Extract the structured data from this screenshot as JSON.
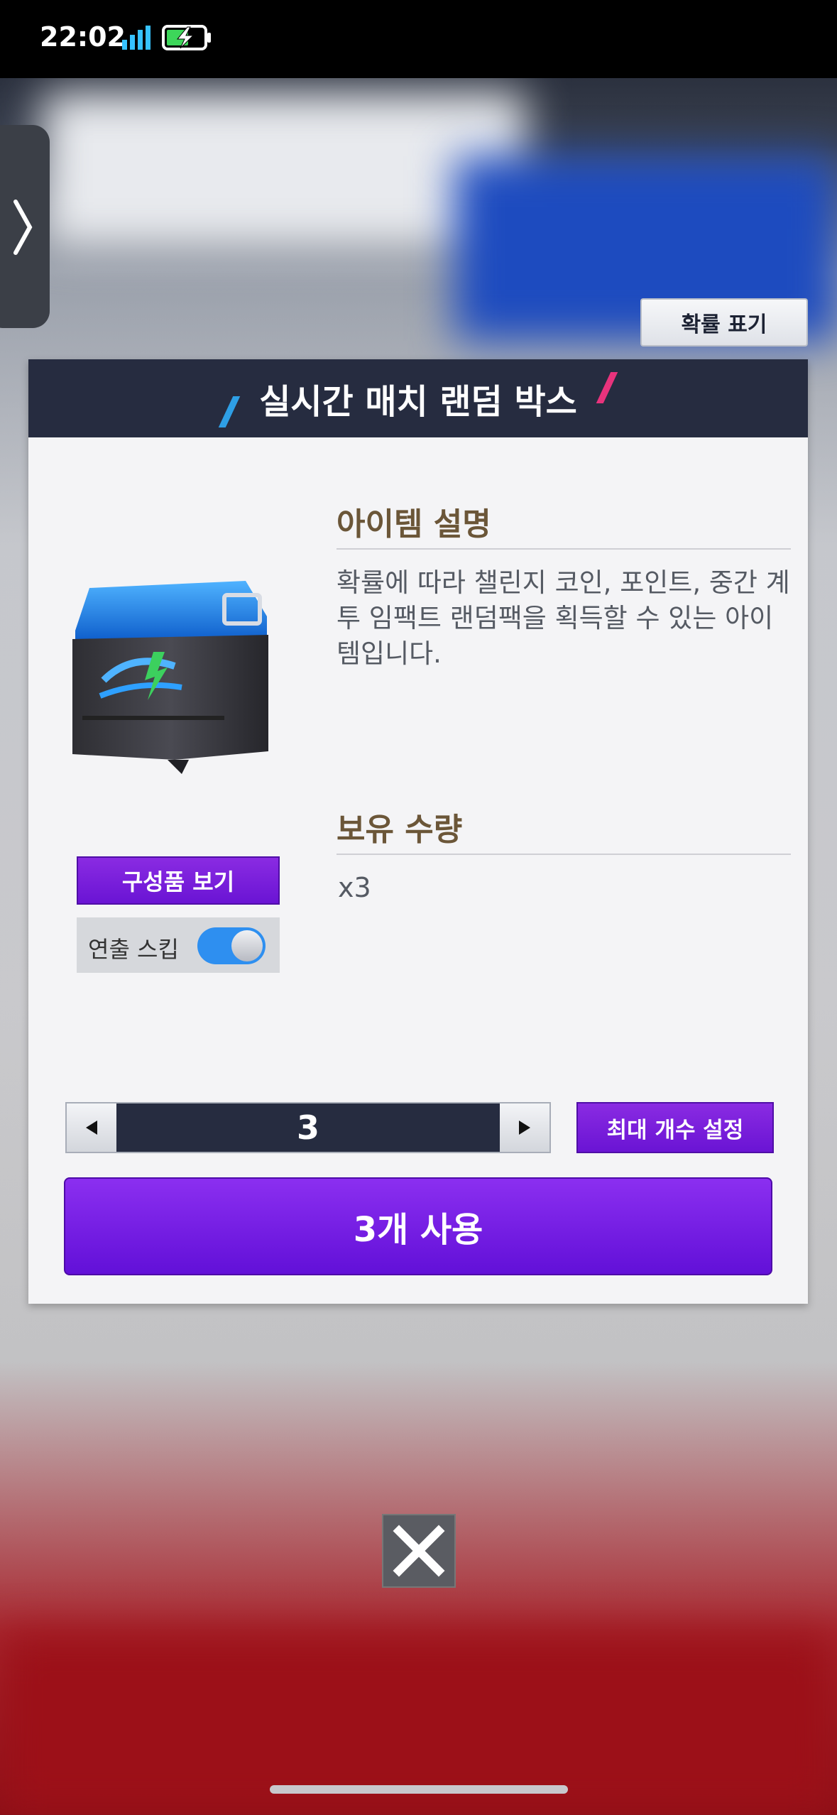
{
  "status_bar": {
    "time": "22:02",
    "signal_icon": "signal-bars-icon",
    "battery_icon": "battery-charging-icon"
  },
  "side_tab": {
    "icon": "chevron-right-icon"
  },
  "probability_button": {
    "label": "확률 표기"
  },
  "panel": {
    "title": "실시간 매치 랜덤 박스",
    "image_icon": "realtime-match-box-icon",
    "item_description": {
      "heading": "아이템 설명",
      "text": "확률에 따라 챌린지 코인, 포인트, 중간 계투 임팩트 랜덤팩을 획득할 수 있는 아이템입니다."
    },
    "owned": {
      "heading": "보유 수량",
      "value": "x3"
    },
    "compose_button": {
      "label": "구성품 보기"
    },
    "skip_toggle": {
      "label": "연출 스킵",
      "on": true
    },
    "stepper": {
      "value": "3",
      "decrease_icon": "triangle-left-icon",
      "increase_icon": "triangle-right-icon"
    },
    "max_button": {
      "label": "최대 개수 설정"
    },
    "use_button": {
      "label": "3개 사용"
    }
  },
  "close_button": {
    "icon": "close-icon"
  },
  "colors": {
    "accent_purple": "#6a14d4",
    "header_navy": "#262c40",
    "toggle_blue": "#2e8ff0",
    "heading_brown": "#6b5638"
  }
}
